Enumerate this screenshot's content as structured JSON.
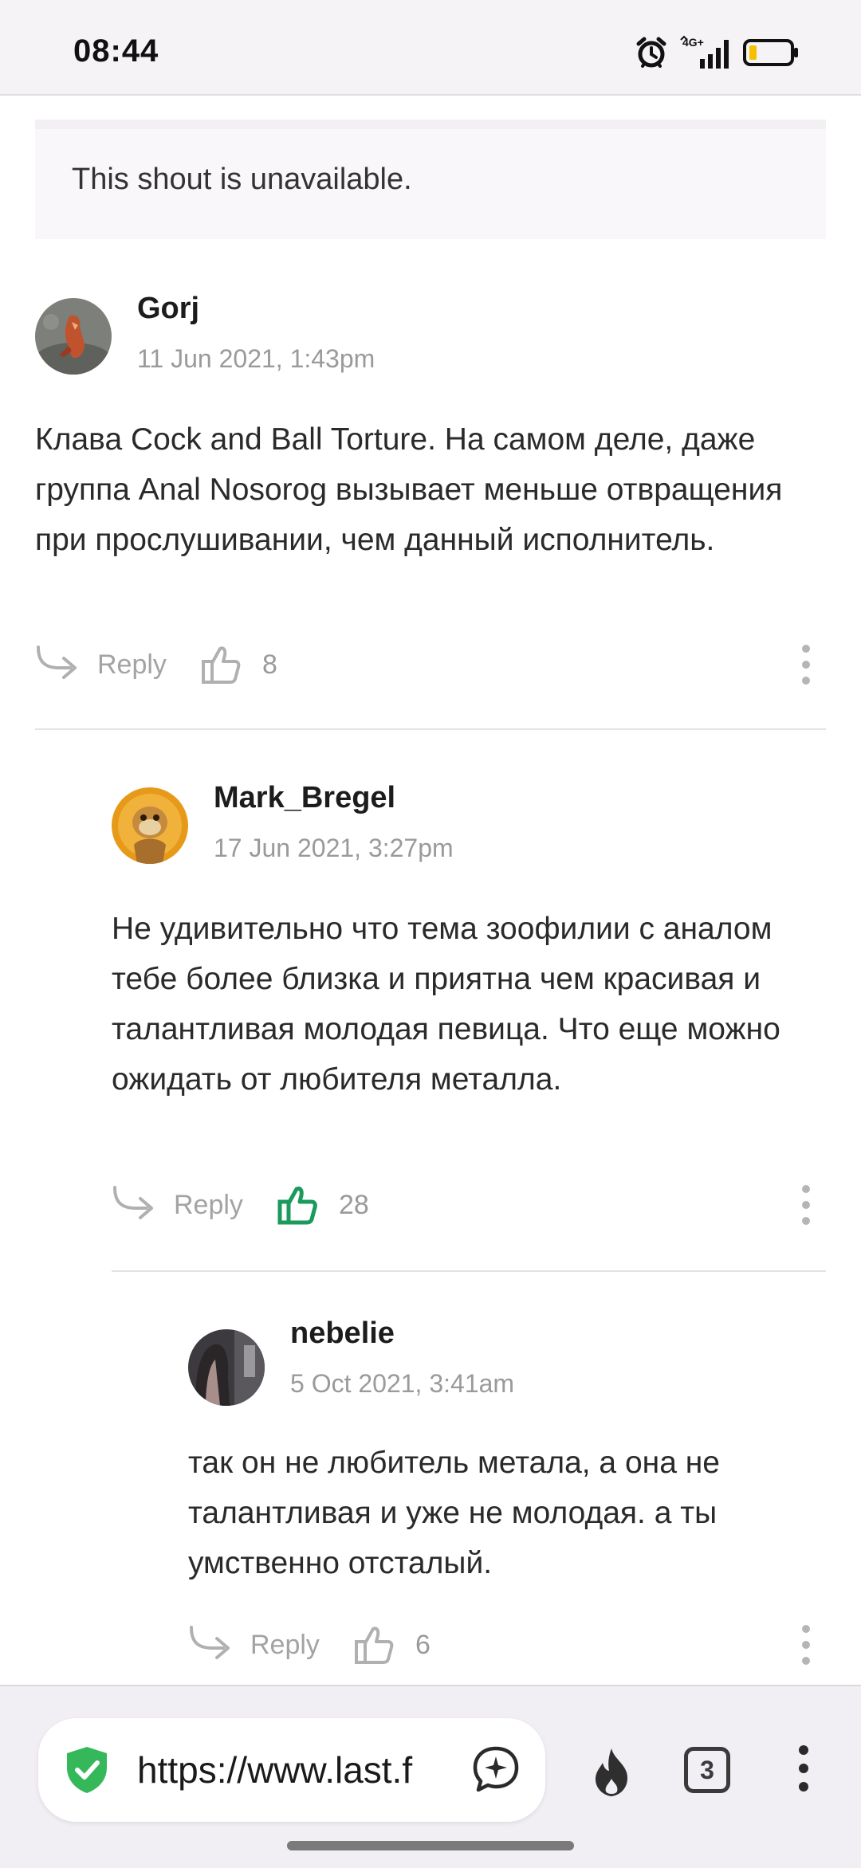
{
  "status_bar": {
    "time": "08:44",
    "icons": [
      "alarm-icon",
      "4g-signal-icon",
      "battery-icon"
    ],
    "network_label": "4G+",
    "battery_color": "#f5c000"
  },
  "unavailable_notice": "This shout is unavailable.",
  "shouts": [
    {
      "author": "Gorj",
      "date": "11 Jun 2021, 1:43pm",
      "text": "Клава Cock and Ball Torture. На самом деле, даже группа Anal Nosorog вызывает меньше отвращения при прослушивании, чем данный исполнитель.",
      "reply_label": "Reply",
      "likes": "8",
      "liked": false
    },
    {
      "author": "Mark_Bregel",
      "date": "17 Jun 2021, 3:27pm",
      "text": "Не удивительно что тема зоофилии с аналом тебе более близка и приятна чем красивая и талантливая молодая певица. Что еще можно ожидать от любителя металла.",
      "reply_label": "Reply",
      "likes": "28",
      "liked": true
    },
    {
      "author": "nebelie",
      "date": "5 Oct 2021, 3:41am",
      "text": "так он не любитель метала, а она не талантливая и уже не молодая. а ты умственно отсталый.",
      "reply_label": "Reply",
      "likes": "6",
      "liked": false
    }
  ],
  "colors": {
    "liked_green": "#1a9a5c",
    "muted_gray": "#a3a3a3",
    "shield_green": "#35b85a"
  },
  "browser": {
    "url": "https://www.last.f",
    "tab_count": "3"
  }
}
